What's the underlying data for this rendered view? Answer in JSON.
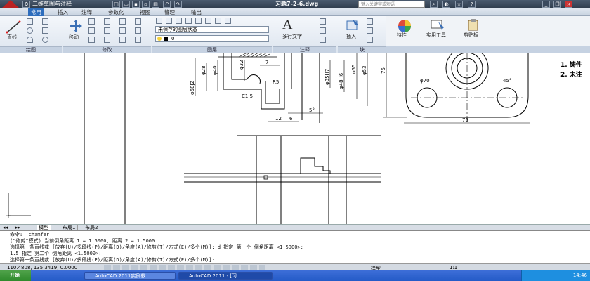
{
  "titlebar": {
    "workspace": "二维草图与注释",
    "document": "习题7-2-6.dwg",
    "search_placeholder": "键入关键字或短语"
  },
  "ribbon_tabs": [
    "常用",
    "插入",
    "注释",
    "参数化",
    "视图",
    "管理",
    "输出"
  ],
  "ribbon": {
    "line_label": "直线",
    "move_label": "移动",
    "layer_state": "未保存的图层状态",
    "layer_current": "0",
    "mtext_label": "多行文字",
    "insert_label": "插入",
    "properties_label": "特性",
    "utilities_label": "实用工具",
    "clipboard_label": "剪贴板",
    "panels": {
      "draw": "绘图",
      "modify": "修改",
      "layers": "图层",
      "annotation": "注释",
      "block": "块"
    }
  },
  "drawing": {
    "dims_left": [
      "φ58J2",
      "φ28",
      "φ40",
      "φ32",
      "7"
    ],
    "dim_chamfer": "C1.5",
    "dim_radius": "R5",
    "dims_mid": [
      "φ35H7",
      "φ48H6",
      "φ55",
      "φ53"
    ],
    "dims_bottom": [
      "12",
      "6"
    ],
    "dim_angle": "5°",
    "dims_right": [
      "75",
      "φ70",
      "75",
      "45°"
    ],
    "notes": [
      "1. 铸件",
      "2. 未注"
    ]
  },
  "layout_tabs": [
    "模型",
    "布局1",
    "布局2"
  ],
  "command_lines": [
    "命令: _chamfer",
    "(\"修剪\"模式) 当前倒角距离 1 = 1.5000, 距离 2 = 1.5000",
    "选择第一条直线或 [放弃(U)/多段线(P)/距离(D)/角度(A)/修剪(T)/方式(E)/多个(M)]:  d 指定 第一个 倒角距离 <1.5000>:",
    "1.5 指定 第二个 倒角距离 <1.5000>:",
    "选择第一条直线或 [放弃(U)/多段线(P)/距离(D)/角度(A)/修剪(T)/方式(E)/多个(M)]:"
  ],
  "status": {
    "coords": "110.4808, 135.3419, 0.0000",
    "model": "模型",
    "scale": "1:1"
  },
  "taskbar": {
    "start": "开始",
    "tasks": [
      "AutoCAD 2011实例教...",
      "AutoCAD 2011 - [习..."
    ],
    "clock": "14:46"
  },
  "colors": {
    "accent_blue": "#2d6dbd",
    "taskbar_blue": "#245bc7",
    "start_green": "#2f8a2c"
  }
}
